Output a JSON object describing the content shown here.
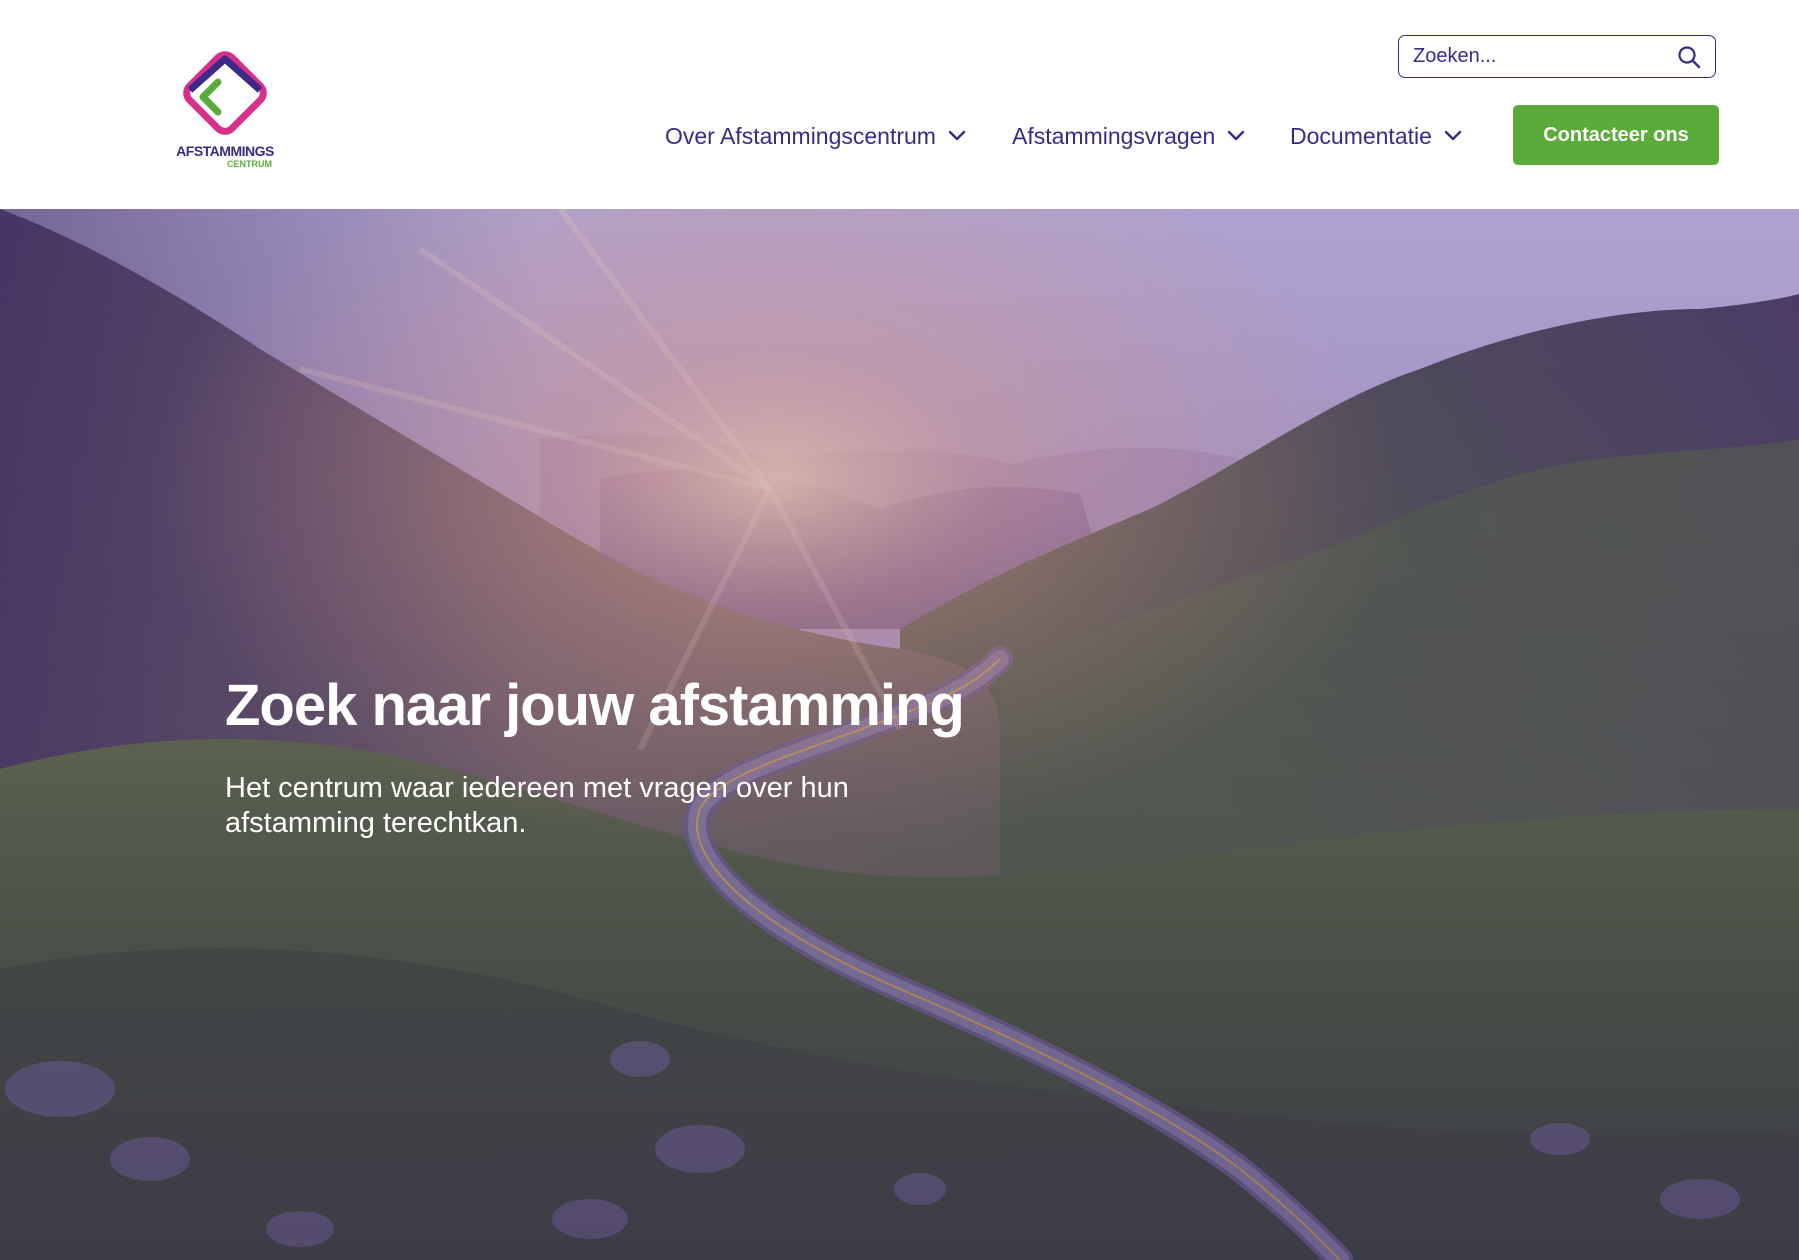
{
  "header": {
    "logo": {
      "word": "AFSTAMMINGS",
      "sub": "CENTRUM"
    },
    "search": {
      "placeholder": "Zoeken...",
      "icon": "search-icon"
    },
    "nav": [
      {
        "label": "Over Afstammingscentrum",
        "icon": "chevron-down-icon"
      },
      {
        "label": "Afstammingsvragen",
        "icon": "chevron-down-icon"
      },
      {
        "label": "Documentatie",
        "icon": "chevron-down-icon"
      }
    ],
    "cta_label": "Contacteer ons"
  },
  "hero": {
    "title": "Zoek naar jouw afstamming",
    "subtitle": "Het centrum waar iedereen met vragen over hun afstamming terechtkan."
  },
  "colors": {
    "brand_purple": "#3b2a86",
    "brand_green": "#5aab3a",
    "brand_pink": "#d6308a",
    "hero_tint": "#5b3f9e"
  }
}
